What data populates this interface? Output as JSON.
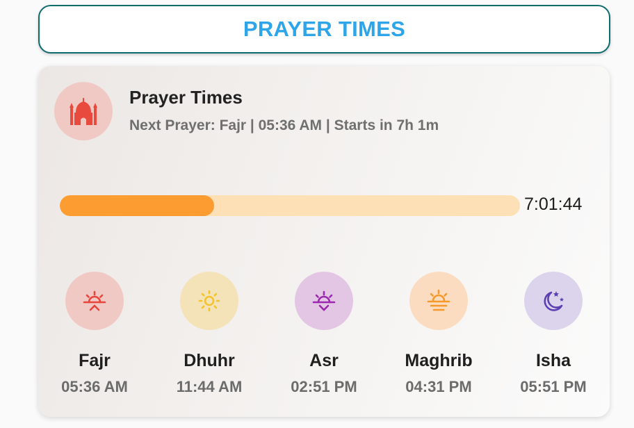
{
  "header": {
    "title": "PRAYER TIMES"
  },
  "card": {
    "title": "Prayer Times",
    "subtitle": "Next Prayer: Fajr | 05:36 AM | Starts in 7h 1m",
    "icon": "mosque-icon"
  },
  "progress": {
    "percent": 33.5,
    "countdown": "7:01:44"
  },
  "prayers": [
    {
      "name": "Fajr",
      "time": "05:36 AM",
      "icon": "sunrise-icon",
      "color": "#e8453c",
      "bg": "#f0c9c4"
    },
    {
      "name": "Dhuhr",
      "time": "11:44 AM",
      "icon": "sun-icon",
      "color": "#f2c32a",
      "bg": "#f4e3b8"
    },
    {
      "name": "Asr",
      "time": "02:51 PM",
      "icon": "sun-down-icon",
      "color": "#9c27b0",
      "bg": "#e3c6e3"
    },
    {
      "name": "Maghrib",
      "time": "04:31 PM",
      "icon": "sunset-icon",
      "color": "#f5992a",
      "bg": "#fbdcc0"
    },
    {
      "name": "Isha",
      "time": "05:51 PM",
      "icon": "moon-stars-icon",
      "color": "#5c3fb0",
      "bg": "#dcd3ec"
    }
  ]
}
